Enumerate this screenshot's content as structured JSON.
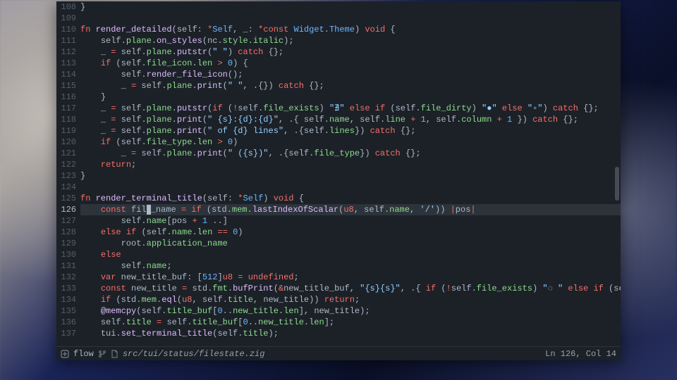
{
  "editor": {
    "filename": "src/tui/status/filestate.zig",
    "mode": "flow",
    "cursor": {
      "line": 126,
      "col": 14
    },
    "status_right": "Ln 126, Col 14",
    "first_line": 108,
    "current_line": 126,
    "lines": [
      {
        "n": 108,
        "t": "}"
      },
      {
        "n": 109,
        "t": ""
      },
      {
        "n": 110,
        "t": "fn render_detailed(self: *Self, _: *const Widget.Theme) void {"
      },
      {
        "n": 111,
        "t": "    self.plane.on_styles(nc.style.italic);"
      },
      {
        "n": 112,
        "t": "    _ = self.plane.putstr(\" \") catch {};"
      },
      {
        "n": 113,
        "t": "    if (self.file_icon.len > 0) {"
      },
      {
        "n": 114,
        "t": "        self.render_file_icon();"
      },
      {
        "n": 115,
        "t": "        _ = self.plane.print(\" \", .{}) catch {};"
      },
      {
        "n": 116,
        "t": "    }"
      },
      {
        "n": 117,
        "t": "    _ = self.plane.putstr(if (!self.file_exists) \"∄\" else if (self.file_dirty) \"●\" else \"▫\") catch {};"
      },
      {
        "n": 118,
        "t": "    _ = self.plane.print(\" {s}:{d}:{d}\", .{ self.name, self.line + 1, self.column + 1 }) catch {};"
      },
      {
        "n": 119,
        "t": "    _ = self.plane.print(\" of {d} lines\", .{self.lines}) catch {};"
      },
      {
        "n": 120,
        "t": "    if (self.file_type.len > 0)"
      },
      {
        "n": 121,
        "t": "        _ = self.plane.print(\" ({s})\", .{self.file_type}) catch {};"
      },
      {
        "n": 122,
        "t": "    return;"
      },
      {
        "n": 123,
        "t": "}"
      },
      {
        "n": 124,
        "t": ""
      },
      {
        "n": 125,
        "t": "fn render_terminal_title(self: *Self) void {"
      },
      {
        "n": 126,
        "t": "    const file_name = if (std.mem.lastIndexOfScalar(u8, self.name, '/')) |pos|"
      },
      {
        "n": 127,
        "t": "        self.name[pos + 1 ..]"
      },
      {
        "n": 128,
        "t": "    else if (self.name.len == 0)"
      },
      {
        "n": 129,
        "t": "        root.application_name"
      },
      {
        "n": 130,
        "t": "    else"
      },
      {
        "n": 131,
        "t": "        self.name;"
      },
      {
        "n": 132,
        "t": "    var new_title_buf: [512]u8 = undefined;"
      },
      {
        "n": 133,
        "t": "    const new_title = std.fmt.bufPrint(&new_title_buf, \"{s}{s}\", .{ if (!self.file_exists) \"◌ \" else if (self.file_dirty) \"● \" else \"\", file"
      },
      {
        "n": 134,
        "t": "    if (std.mem.eql(u8, self.title, new_title)) return;"
      },
      {
        "n": 135,
        "t": "    @memcpy(self.title_buf[0..new_title.len], new_title);"
      },
      {
        "n": 136,
        "t": "    self.title = self.title_buf[0..new_title.len];"
      },
      {
        "n": 137,
        "t": "    tui.set_terminal_title(self.title);"
      }
    ]
  },
  "colors": {
    "bg": "#1c2128",
    "fg": "#adbac7",
    "gutter": "#545d68",
    "keyword": "#f47067",
    "function": "#dcbdfb",
    "type": "#6cb6ff",
    "string": "#96d0ff",
    "property": "#8ddb8c"
  },
  "icons": {
    "brand": "brand-icon",
    "git": "git-branch-icon",
    "file": "file-icon"
  }
}
